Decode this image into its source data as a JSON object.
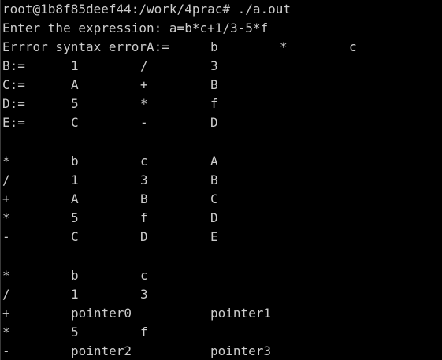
{
  "terminal": {
    "prompt": "root@1b8f85deef44:/work/4prac# ./a.out",
    "input_line": "Enter the expression: a=b*c+1/3-5*f",
    "error_line": {
      "prefix": "Errror syntax errorA:=",
      "col3": "b",
      "col4": "*",
      "col5": "c"
    },
    "block1": [
      [
        "B:=",
        "1",
        "/",
        "3"
      ],
      [
        "C:=",
        "A",
        "+",
        "B"
      ],
      [
        "D:=",
        "5",
        "*",
        "f"
      ],
      [
        "E:=",
        "C",
        "-",
        "D"
      ]
    ],
    "block2": [
      [
        "*",
        "b",
        "c",
        "A"
      ],
      [
        "/",
        "1",
        "3",
        "B"
      ],
      [
        "+",
        "A",
        "B",
        "C"
      ],
      [
        "*",
        "5",
        "f",
        "D"
      ],
      [
        "-",
        "C",
        "D",
        "E"
      ]
    ],
    "block3": [
      [
        "*",
        "b",
        "c",
        ""
      ],
      [
        "/",
        "1",
        "3",
        ""
      ],
      [
        "+",
        "pointer0",
        "",
        "pointer1"
      ],
      [
        "*",
        "5",
        "f",
        ""
      ],
      [
        "-",
        "pointer2",
        "",
        "pointer3"
      ]
    ]
  },
  "colors": {
    "background": "#000000",
    "text": "#cccccc"
  }
}
